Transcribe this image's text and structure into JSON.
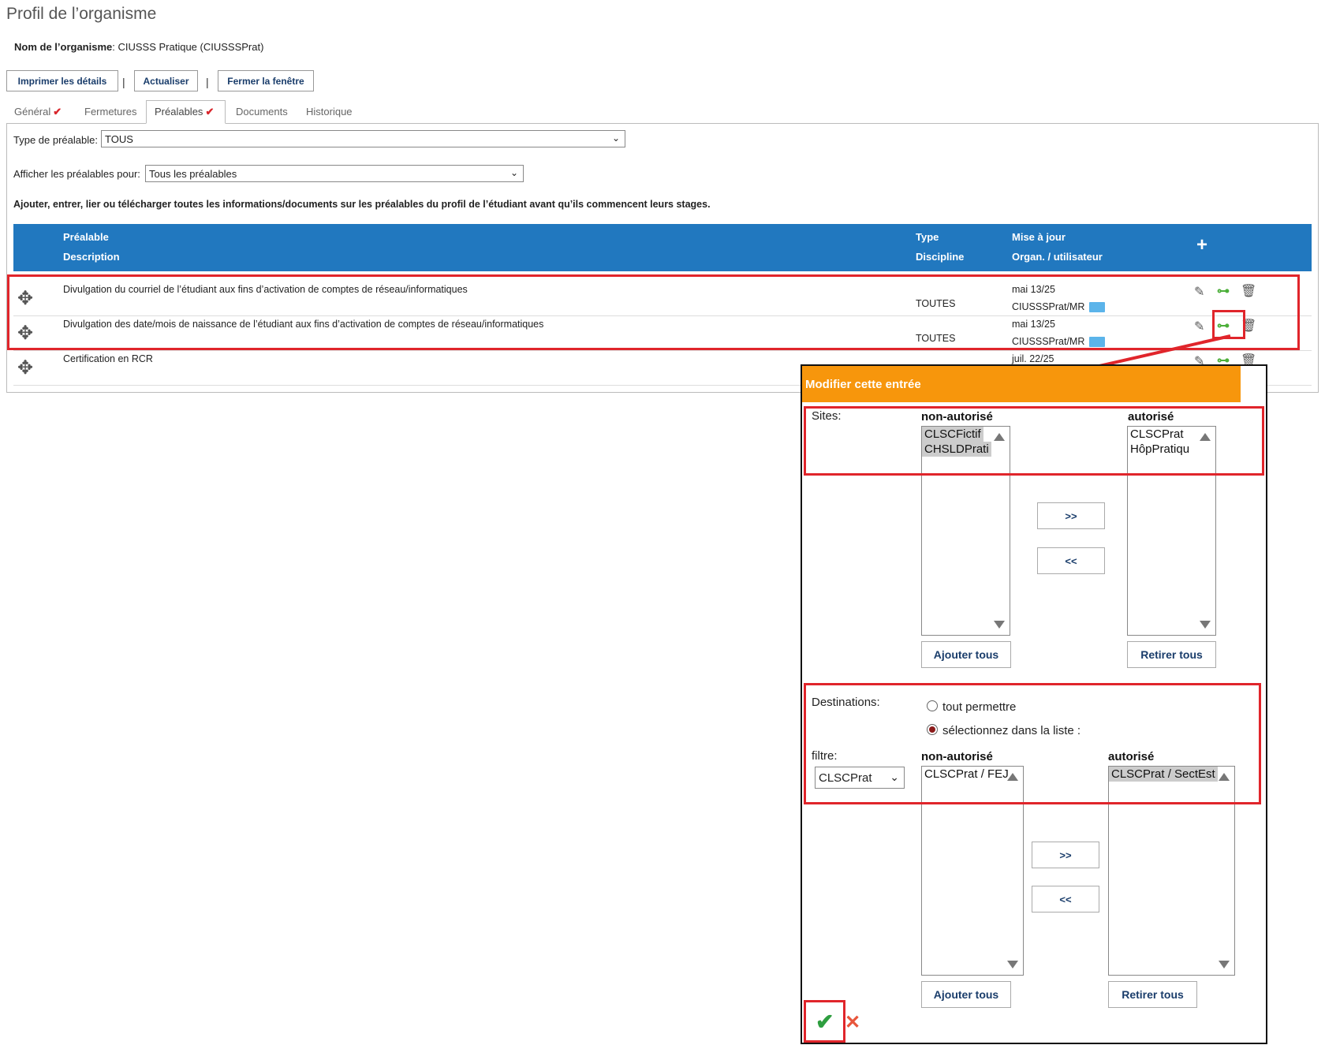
{
  "page": {
    "title": "Profil de l’organisme",
    "org_label": "Nom de l’organisme",
    "org_value": ": CIUSSS Pratique (CIUSSSPrat)"
  },
  "toolbar": {
    "print_label": "Imprimer les détails",
    "refresh_label": "Actualiser",
    "close_label": "Fermer la fenêtre",
    "separator": "|"
  },
  "tabs": [
    {
      "label": "Général",
      "checked": true
    },
    {
      "label": "Fermetures",
      "checked": false
    },
    {
      "label": "Préalables",
      "checked": true,
      "active": true
    },
    {
      "label": "Documents",
      "checked": false
    },
    {
      "label": "Historique",
      "checked": false
    }
  ],
  "filters": {
    "type_label": "Type de préalable:",
    "type_value": "TOUS",
    "show_label": "Afficher les préalables pour:",
    "show_value": "Tous les préalables"
  },
  "instructions": "Ajouter, entrer, lier ou télécharger toutes les informations/documents sur les préalables du profil de l’étudiant avant qu’ils commencent leurs stages.",
  "table": {
    "col1_line1": "Préalable",
    "col1_line2": "Description",
    "col2_line1": "Type",
    "col2_line2": "Discipline",
    "col3_line1": "Mise à jour",
    "col3_line2": "Organ. / utilisateur",
    "add_glyph": "+",
    "rows": [
      {
        "name": "Divulgation du courriel de l’étudiant aux fins d’activation de comptes de réseau/informatiques",
        "discipline": "TOUTES",
        "date": "mai 13/25",
        "user": "CIUSSSPrat/MR"
      },
      {
        "name": "Divulgation des date/mois de naissance de l’étudiant aux fins d’activation de comptes de réseau/informatiques",
        "discipline": "TOUTES",
        "date": "mai 13/25",
        "user": "CIUSSSPrat/MR"
      },
      {
        "name": "Certification en RCR",
        "discipline": "",
        "date": "juil. 22/25",
        "user": ""
      }
    ]
  },
  "modal": {
    "title": "Modifier cette entrée",
    "sites_label": "Sites:",
    "not_allowed": "non-autorisé",
    "allowed": "autorisé",
    "sites_not_allowed": [
      "CLSCFictif",
      "CHSLDPrati"
    ],
    "sites_allowed": [
      "CLSCPrat",
      "HôpPratiqu"
    ],
    "move_right": ">>",
    "move_left": "<<",
    "add_all": "Ajouter tous",
    "remove_all": "Retirer tous",
    "dest_label": "Destinations:",
    "radio_all": "tout permettre",
    "radio_select": "sélectionnez dans la liste :",
    "filter_label": "filtre:",
    "filter_value": "CLSCPrat",
    "dest_not_allowed": [
      "CLSCPrat / FEJ"
    ],
    "dest_allowed": [
      "CLSCPrat / SectEst"
    ],
    "confirm_glyph": "✔",
    "cancel_glyph": "✕"
  },
  "colors": {
    "header_blue": "#2178bf",
    "modal_orange": "#f7960c",
    "highlight_red": "#e0252b",
    "confirm_green": "#2e9e3f"
  }
}
